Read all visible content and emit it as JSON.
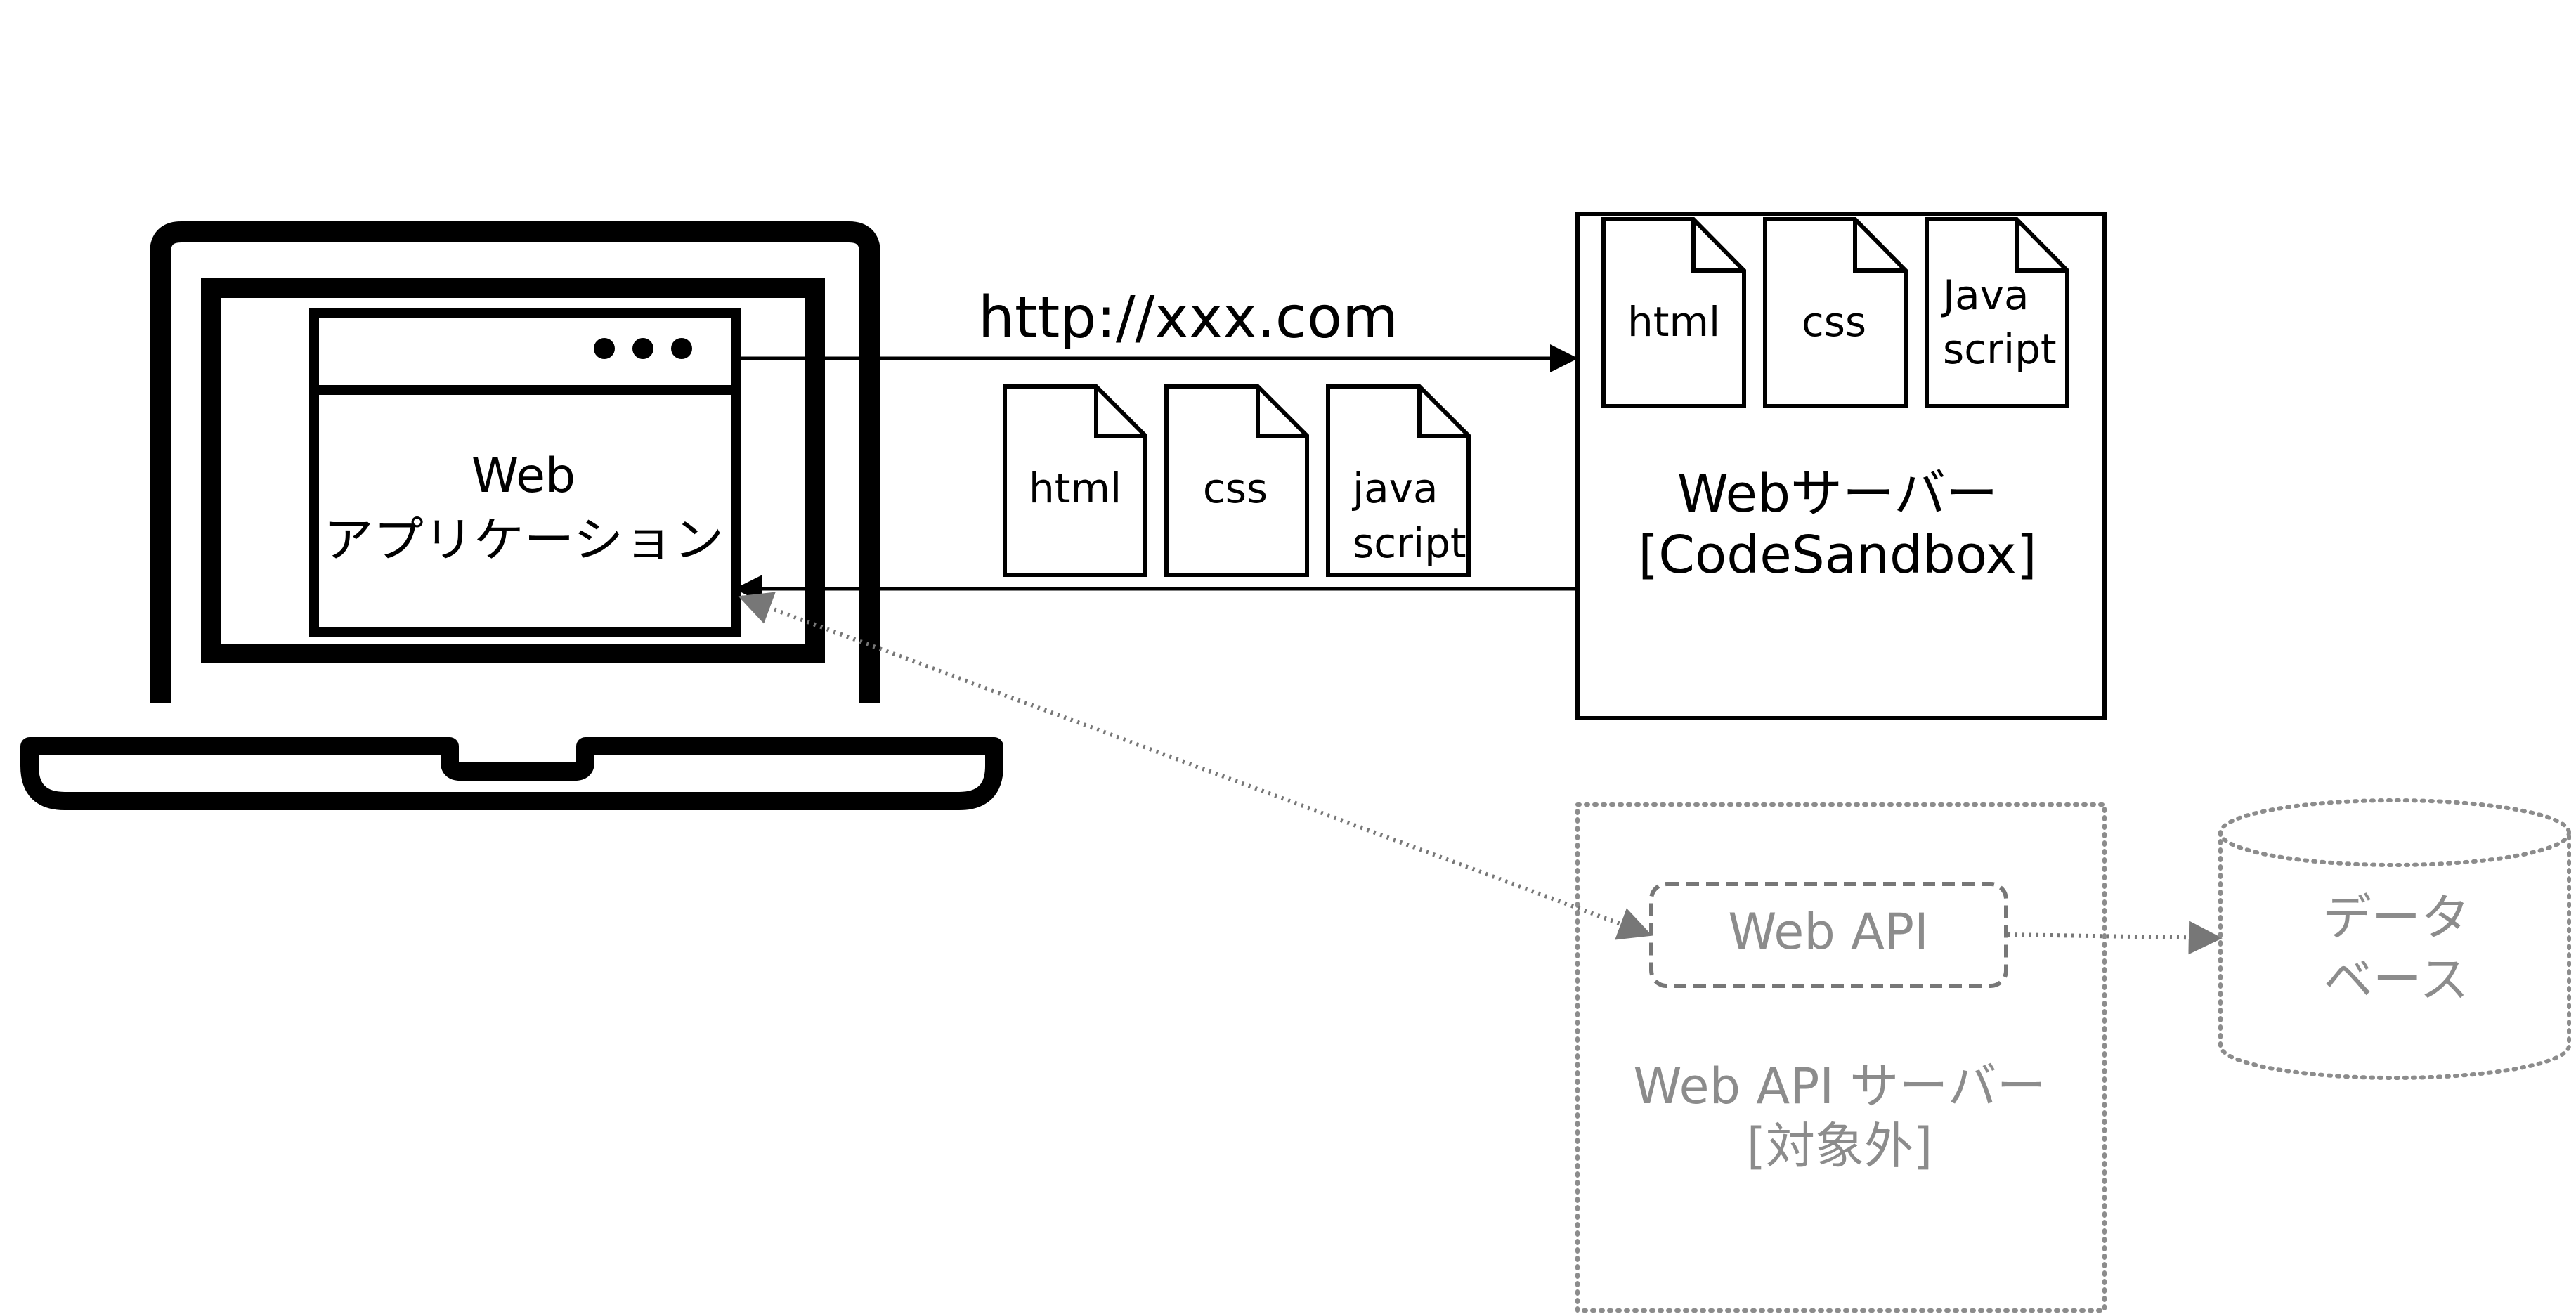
{
  "colors": {
    "primary": "#000000",
    "muted": "#8c8c8c",
    "background": "#ffffff"
  },
  "client": {
    "icon": "laptop-icon",
    "window_dots_icon": "more-dots-icon",
    "app_label_line1": "Web",
    "app_label_line2": "アプリケーション"
  },
  "request": {
    "url": "http://xxx.com"
  },
  "response_files": [
    {
      "icon": "document-icon",
      "line1": "html",
      "line2": ""
    },
    {
      "icon": "document-icon",
      "line1": "css",
      "line2": ""
    },
    {
      "icon": "document-icon",
      "line1": "java",
      "line2": "script"
    }
  ],
  "web_server": {
    "label_line1": "Webサーバー",
    "label_line2": "[CodeSandbox]",
    "files": [
      {
        "icon": "document-icon",
        "line1": "html",
        "line2": ""
      },
      {
        "icon": "document-icon",
        "line1": "css",
        "line2": ""
      },
      {
        "icon": "document-icon",
        "line1": "Java",
        "line2": "script"
      }
    ]
  },
  "api_server": {
    "label_line1": "Web API サーバー",
    "label_line2": "[対象外]",
    "api_box_label": "Web API"
  },
  "database": {
    "icon": "database-icon",
    "label_line1": "データ",
    "label_line2": "ベース"
  }
}
